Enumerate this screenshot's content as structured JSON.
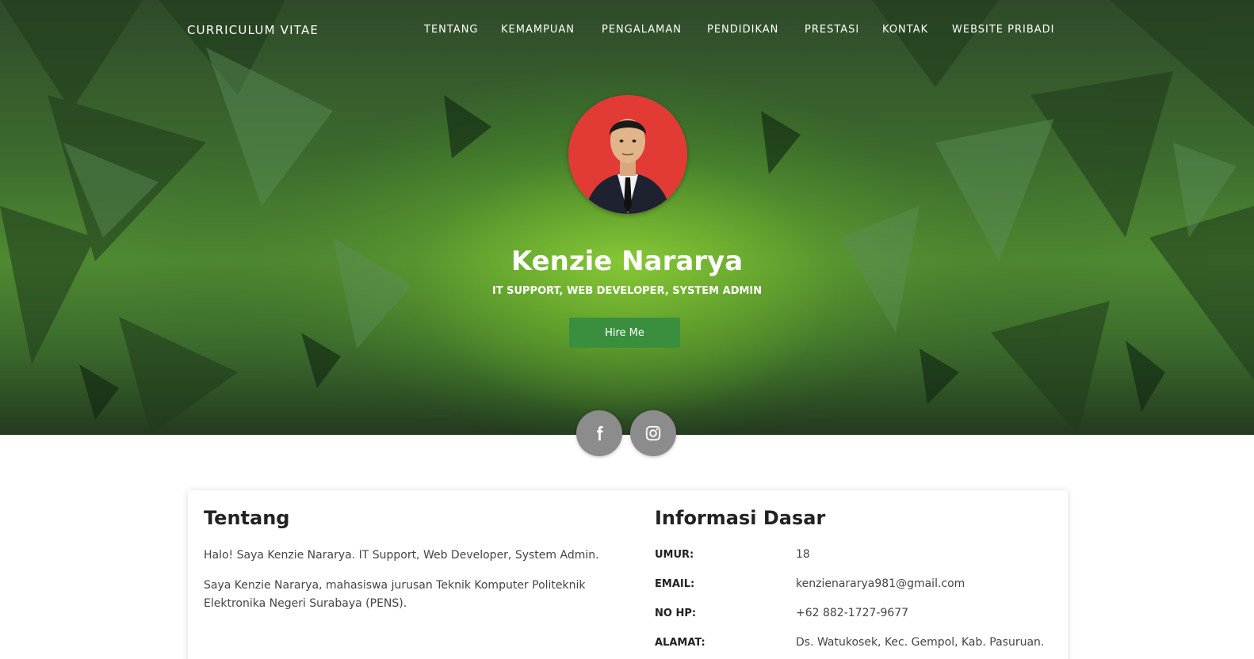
{
  "brand": "CURRICULUM VITAE",
  "nav": [
    "TENTANG",
    "KEMAMPUAN",
    "PENGALAMAN",
    "PENDIDIKAN",
    "PRESTASI",
    "KONTAK",
    "WEBSITE PRIBADI"
  ],
  "hero": {
    "name": "Kenzie Nararya",
    "title": "IT SUPPORT, WEB DEVELOPER, SYSTEM ADMIN",
    "hire_label": "Hire Me"
  },
  "social": [
    "facebook-icon",
    "instagram-icon"
  ],
  "about": {
    "heading": "Tentang",
    "p1": "Halo! Saya Kenzie Nararya. IT Support, Web Developer, System Admin.",
    "p2_line1": "Saya Kenzie Nararya, mahasiswa jurusan Teknik Komputer Politeknik",
    "p2_line2": "Elektronika Negeri Surabaya (PENS)."
  },
  "info": {
    "heading": "Informasi Dasar",
    "rows": [
      {
        "label": "UMUR:",
        "value": "18"
      },
      {
        "label": "EMAIL:",
        "value": "kenzienararya981@gmail.com"
      },
      {
        "label": "NO HP:",
        "value": "+62 882-1727-9677"
      },
      {
        "label": "ALAMAT:",
        "value": "Ds. Watukosek, Kec. Gempol, Kab. Pasuruan."
      }
    ]
  },
  "colors": {
    "accent": "#3a8f3f",
    "avatar_bg": "#e23b35",
    "social_bg": "#8c8c8c"
  }
}
